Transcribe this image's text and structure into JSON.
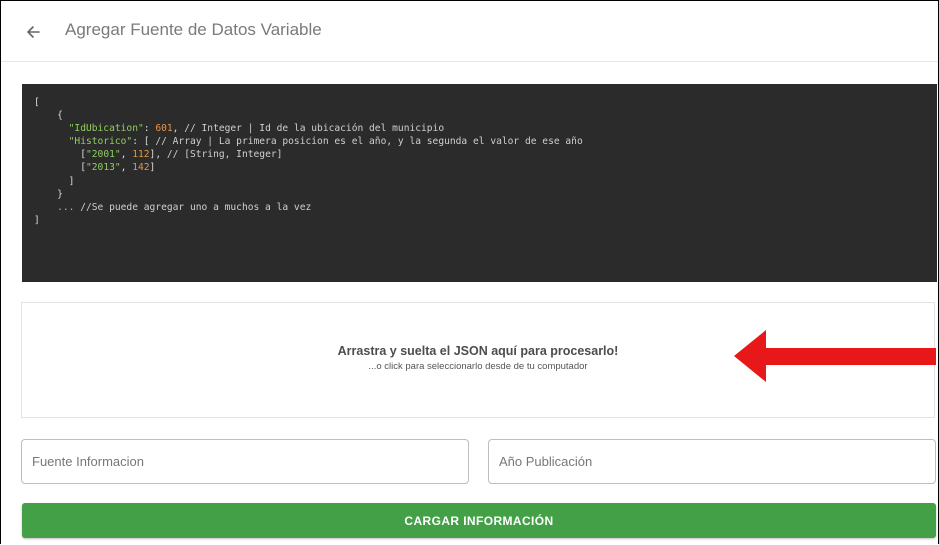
{
  "header": {
    "title": "Agregar Fuente de Datos Variable",
    "back_icon": "arrow-left-icon"
  },
  "code_example": {
    "line1": "[",
    "line2": "{",
    "key_id": "\"IdUbication\"",
    "val_id": "601",
    "cmt_id": "// Integer | Id de la ubicación del municipio",
    "key_hist": "\"Historico\"",
    "cmt_hist": "// Array | La primera posicion es el año, y la segunda el valor de ese año",
    "row1_year": "\"2001\"",
    "row1_val": "112",
    "row1_cmt": "// [String, Integer]",
    "row2_year": "\"2013\"",
    "row2_val": "142",
    "close_arr": "]",
    "close_obj": "}",
    "more": "...",
    "more_cmt": "//Se puede agregar uno a muchos a la vez",
    "close_root": "]"
  },
  "dropzone": {
    "title": "Arrastra y suelta el JSON aquí para procesarlo!",
    "subtitle": "...o click para seleccionarlo desde de tu computador",
    "arrow_color": "#e8171a"
  },
  "form": {
    "source_placeholder": "Fuente Informacion",
    "year_placeholder": "Año Publicación",
    "submit_label": "CARGAR INFORMACIÓN",
    "submit_color": "#43a047"
  }
}
